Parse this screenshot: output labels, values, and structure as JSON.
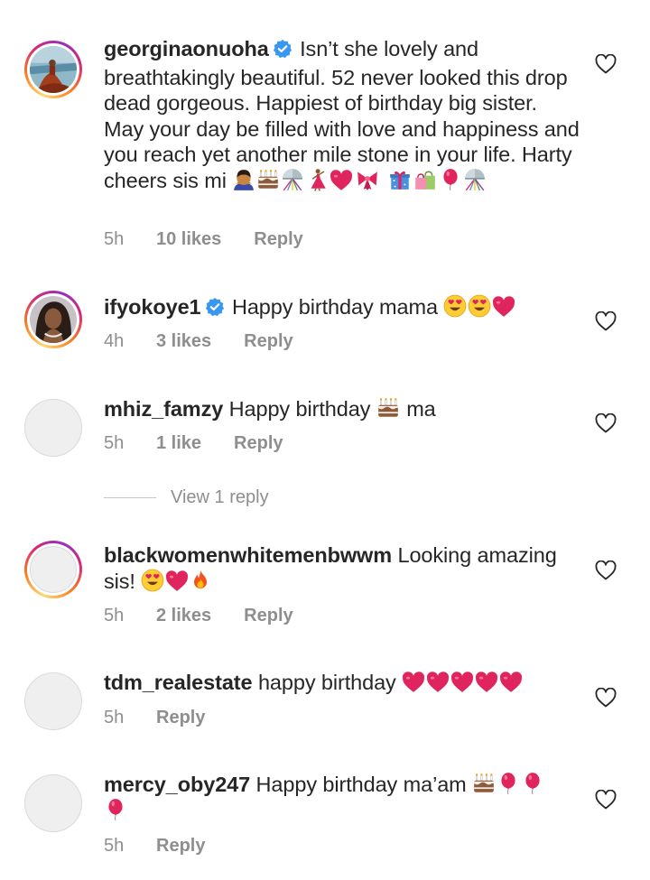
{
  "comments": [
    {
      "username": "georginaonuoha",
      "verified": true,
      "text": "Isn’t she lovely and breathtakingly beautiful. 52 never looked this drop dead gorgeous. Happiest of birthday big sister. May your day be filled with love and happiness and you reach yet another mile stone in your life. Harty cheers sis mi",
      "emojis": [
        "person-bowing",
        "birthday-cake",
        "confetti-ball",
        "dancing-woman",
        "red-heart",
        "ribbon",
        "wrapped-gift",
        "shopping-bags",
        "red-balloon",
        "confetti-ball"
      ],
      "time": "5h",
      "likes": "10 likes",
      "reply": "Reply"
    },
    {
      "username": "ifyokoye1",
      "verified": true,
      "text": "Happy birthday mama",
      "emojis": [
        "heart-eyes-face",
        "heart-eyes-face",
        "red-heart"
      ],
      "time": "4h",
      "likes": "3 likes",
      "reply": "Reply"
    },
    {
      "username": "mhiz_famzy",
      "verified": false,
      "text": "Happy birthday",
      "text_after": "ma",
      "emojis": [
        "birthday-cake"
      ],
      "time": "5h",
      "likes": "1 like",
      "reply": "Reply"
    },
    {
      "username": "blackwomenwhitemenbwwm",
      "verified": false,
      "text": "Looking amazing sis!",
      "emojis": [
        "heart-eyes-face",
        "red-heart",
        "fire"
      ],
      "time": "5h",
      "likes": "2 likes",
      "reply": "Reply"
    },
    {
      "username": "tdm_realestate",
      "verified": false,
      "text": "happy birthday",
      "emojis": [
        "red-heart",
        "red-heart",
        "red-heart",
        "red-heart",
        "red-heart"
      ],
      "time": "5h",
      "likes": "",
      "reply": "Reply"
    },
    {
      "username": "mercy_oby247",
      "verified": false,
      "text": "Happy birthday ma’am",
      "emojis": [
        "birthday-cake",
        "red-balloon",
        "red-balloon",
        "red-balloon"
      ],
      "time": "5h",
      "likes": "",
      "reply": "Reply"
    }
  ],
  "view_replies_label": "View 1 reply",
  "colors": {
    "verified_badge": "#3897f0",
    "meta_text": "#8e8e8e",
    "heart_outline": "#262626"
  }
}
